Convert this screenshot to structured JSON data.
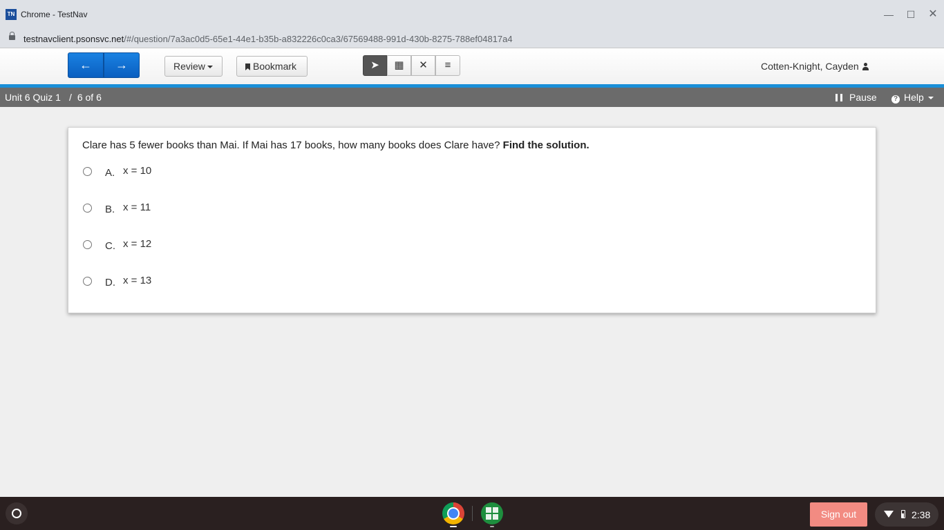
{
  "window": {
    "badge": "TN",
    "title": "Chrome - TestNav",
    "minimize": "—",
    "maximize": "☐",
    "close": "✕"
  },
  "address": {
    "domain": "testnavclient.psonsvc.net",
    "path": "/#/question/7a3ac0d5-65e1-44e1-b35b-a832226c0ca3/67569488-991d-430b-8275-788ef04817a4"
  },
  "toolbar": {
    "prev_glyph": "←",
    "next_glyph": "→",
    "review_label": "Review",
    "bookmark_label": "Bookmark",
    "tools": [
      {
        "name": "pointer",
        "glyph": "➤"
      },
      {
        "name": "calculator",
        "glyph": "▦"
      },
      {
        "name": "answer-eliminator",
        "glyph": "✕"
      },
      {
        "name": "notepad",
        "glyph": "≡"
      }
    ],
    "user_name": "Cotten-Knight, Cayden"
  },
  "status": {
    "quiz_name": "Unit 6 Quiz 1",
    "separator": "/",
    "progress": "6 of 6",
    "pause_label": "Pause",
    "help_label": "Help",
    "help_glyph": "?"
  },
  "question": {
    "prompt": "Clare has 5 fewer books than Mai. If Mai has 17 books, how many books does Clare have? ",
    "prompt_bold": "Find the solution.",
    "choices": [
      {
        "letter": "A.",
        "text": "x = 10"
      },
      {
        "letter": "B.",
        "text": "x = 11"
      },
      {
        "letter": "C.",
        "text": "x = 12"
      },
      {
        "letter": "D.",
        "text": "x = 13"
      }
    ],
    "selected": null
  },
  "shelf": {
    "signout_label": "Sign out",
    "time": "2:38"
  },
  "colors": {
    "nav_blue": "#0a5fc0",
    "accent_stripe": "#1a8fd8",
    "status_gray": "#6b6b6b",
    "signout": "#f28b82"
  }
}
